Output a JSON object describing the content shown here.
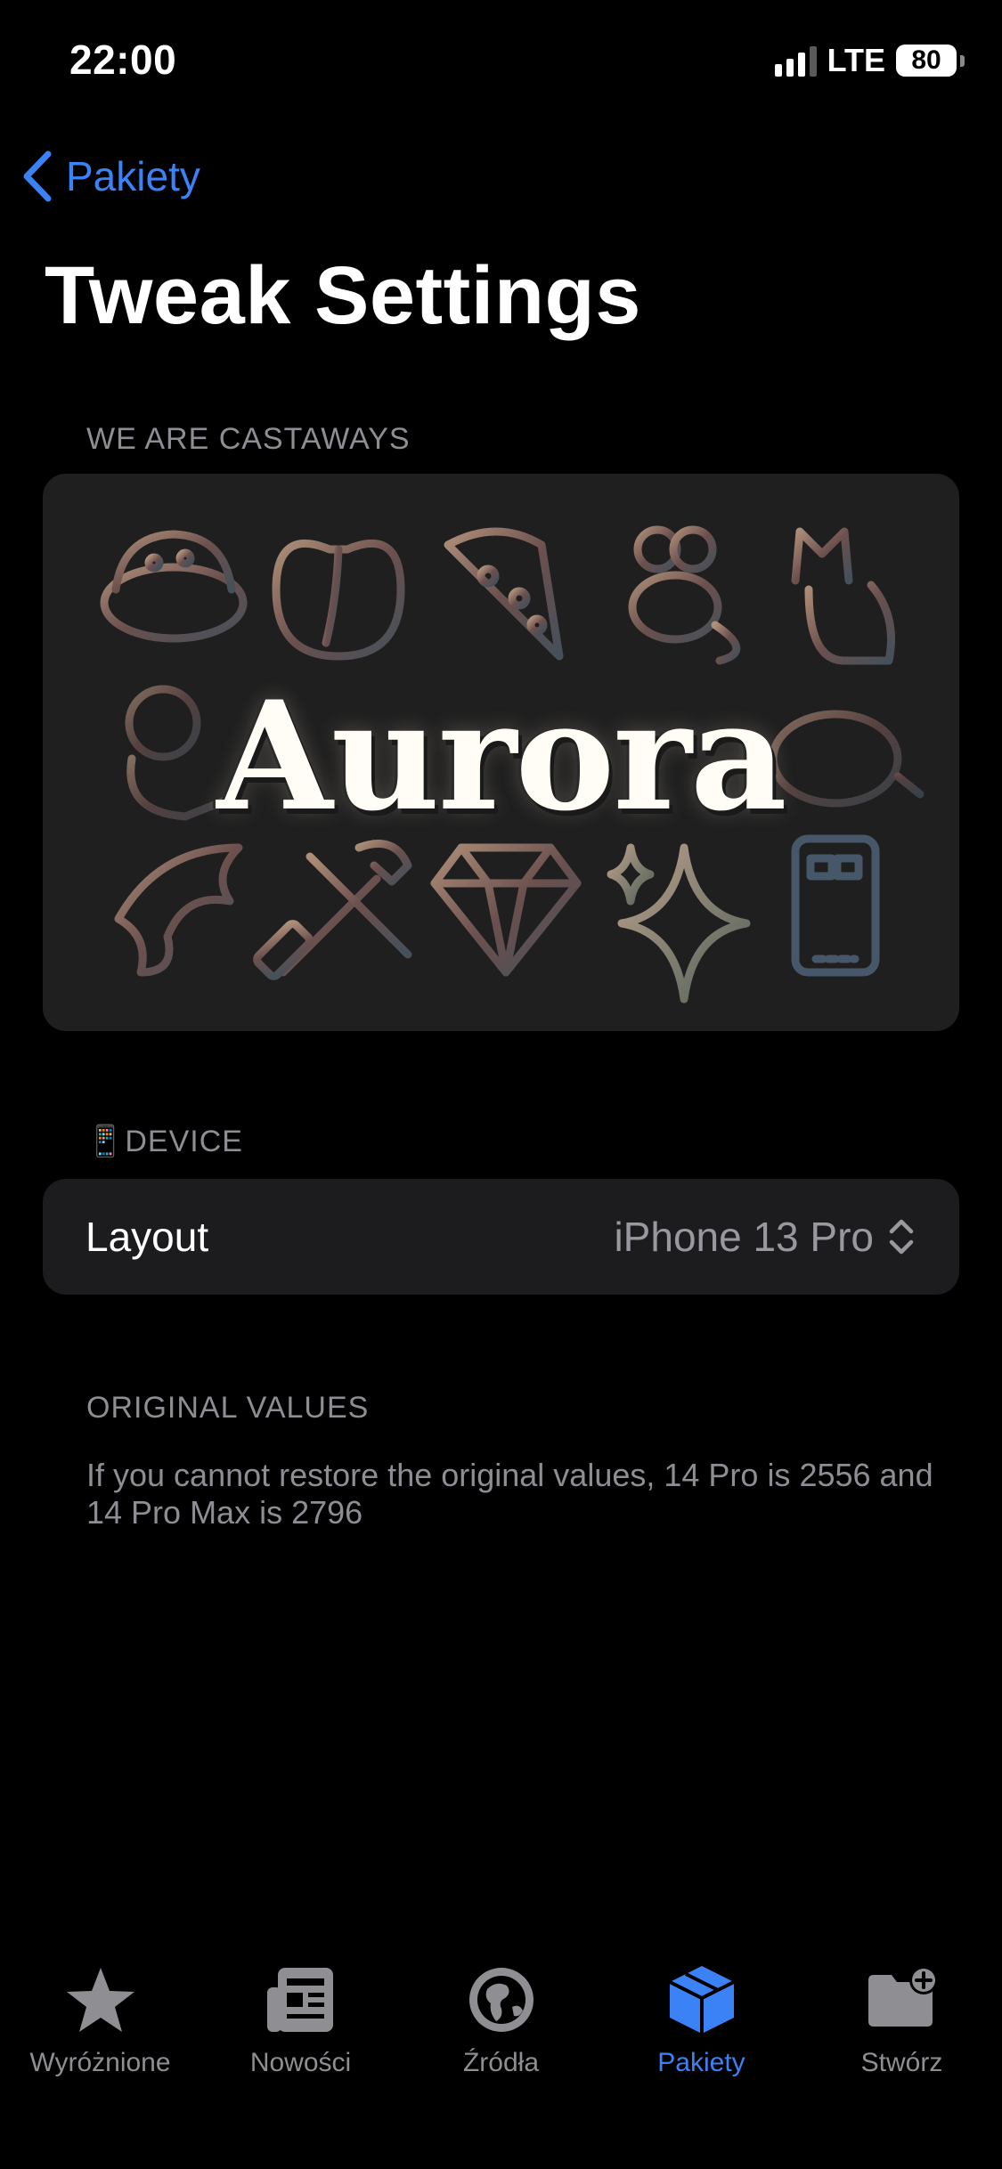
{
  "status": {
    "time": "22:00",
    "network": "LTE",
    "battery": "80"
  },
  "nav": {
    "back_label": "Pakiety",
    "title": "Tweak Settings"
  },
  "sections": {
    "castaways_header": "WE ARE CASTAWAYS",
    "banner_word": "Aurora",
    "device_header_emoji": "📱",
    "device_header": "DEVICE",
    "original_header": "ORIGINAL VALUES",
    "original_footer": "If you cannot restore the original values, 14 Pro is 2556 and 14 Pro Max is 2796"
  },
  "layout_row": {
    "label": "Layout",
    "value": "iPhone 13 Pro"
  },
  "tabs": [
    {
      "label": "Wyróżnione",
      "icon": "star-icon"
    },
    {
      "label": "Nowości",
      "icon": "newspaper-icon"
    },
    {
      "label": "Źródła",
      "icon": "globe-icon"
    },
    {
      "label": "Pakiety",
      "icon": "package-icon",
      "active": true
    },
    {
      "label": "Stwórz",
      "icon": "folder-add-icon"
    }
  ],
  "colors": {
    "accent": "#3b82f6",
    "card": "#1c1c1e",
    "secondary_text": "#8d8d93"
  }
}
